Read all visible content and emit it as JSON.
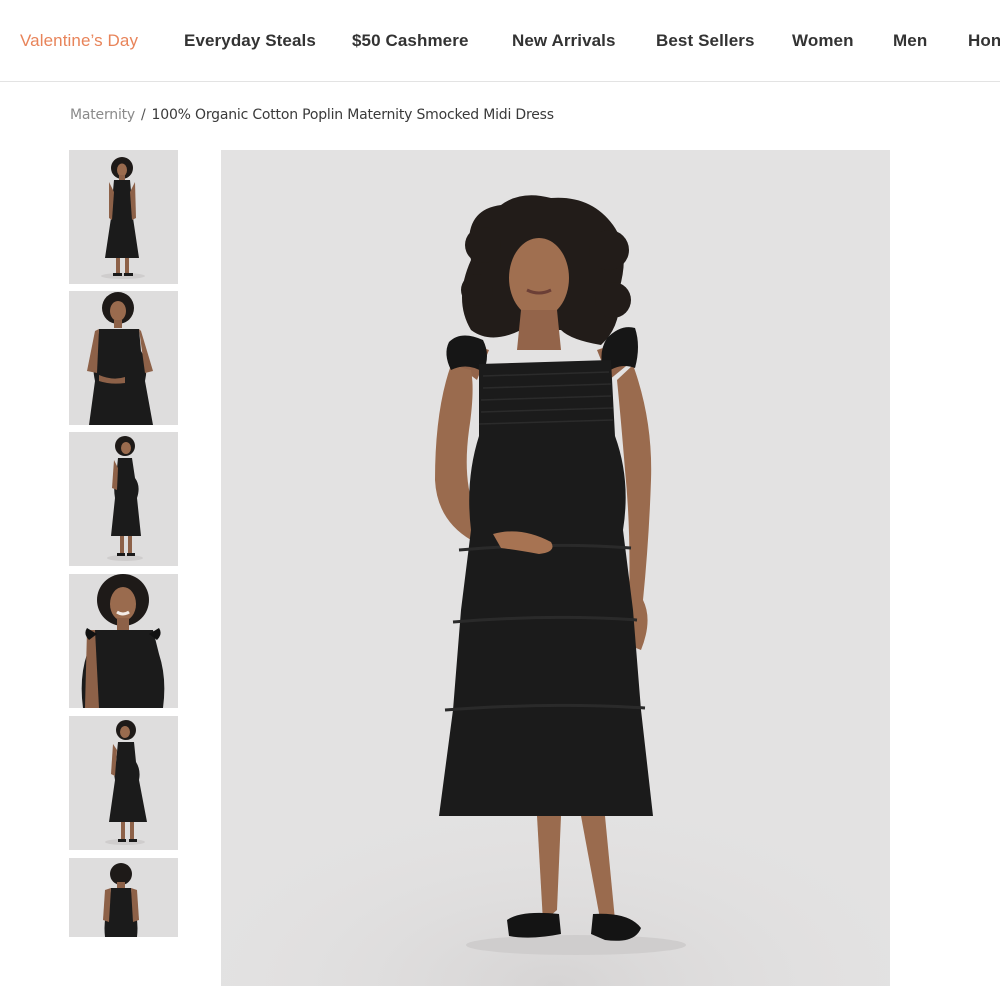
{
  "nav": {
    "items": [
      {
        "label": "Valentine’s Day",
        "active": true
      },
      {
        "label": "Everyday Steals"
      },
      {
        "label": "$50 Cashmere"
      },
      {
        "label": "New Arrivals"
      },
      {
        "label": "Best Sellers"
      },
      {
        "label": "Women"
      },
      {
        "label": "Men"
      },
      {
        "label": "Hon"
      }
    ],
    "accent_color": "#e8845a"
  },
  "breadcrumb": {
    "parent": "Maternity",
    "separator": "/",
    "current": "100% Organic Cotton Poplin Maternity Smocked Midi Dress"
  },
  "gallery": {
    "thumbnails": [
      {
        "pose": "full-body-front"
      },
      {
        "pose": "three-quarter-front"
      },
      {
        "pose": "full-body-side"
      },
      {
        "pose": "close-up-smiling"
      },
      {
        "pose": "full-body-turned"
      },
      {
        "pose": "full-body-back"
      }
    ],
    "main_pose": "full-body-front",
    "product_color": "#1c1c1c",
    "background_color": "#e2e1e1"
  }
}
